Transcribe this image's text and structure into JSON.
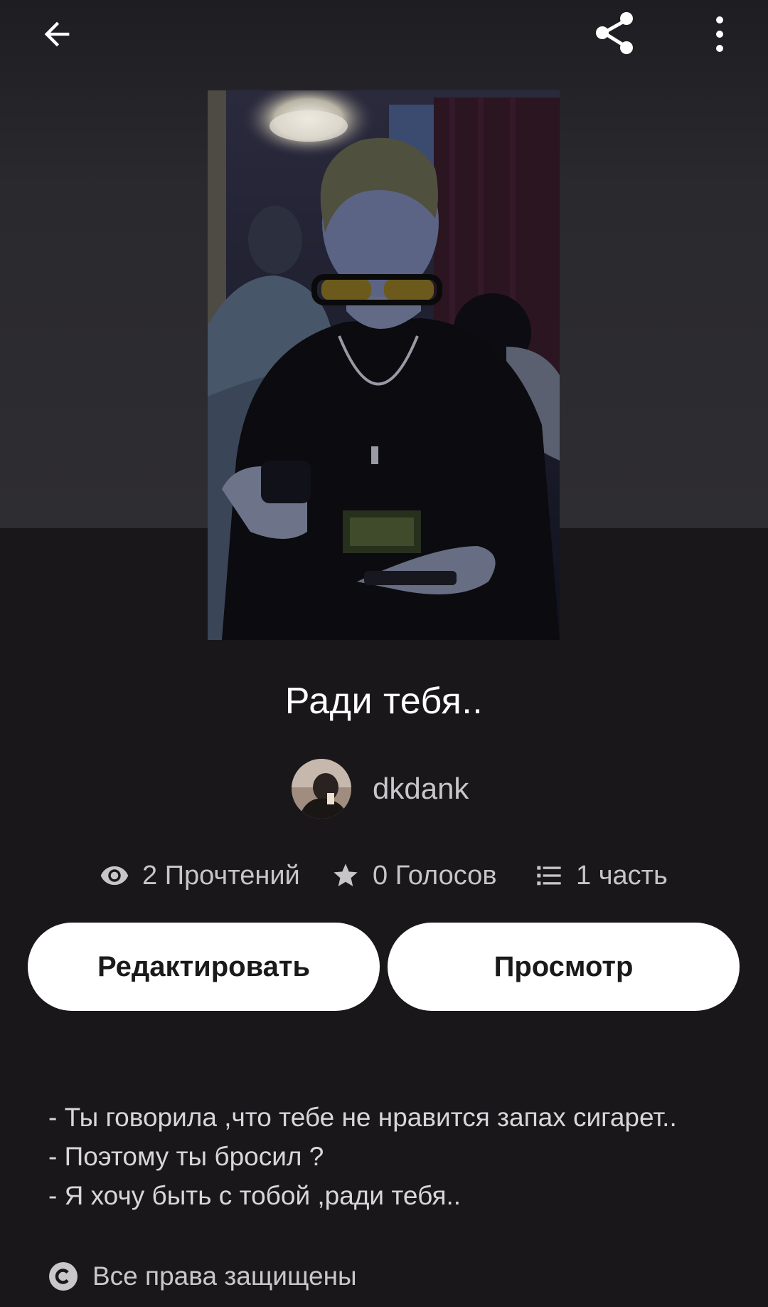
{
  "header": {
    "back_icon": "arrow-left-icon",
    "share_icon": "share-icon",
    "more_icon": "more-vertical-icon"
  },
  "story": {
    "title": "Ради тебя..",
    "author": "dkdank",
    "stats": {
      "reads": "2 Прочтений",
      "votes": "0 Голосов",
      "parts": "1 часть"
    }
  },
  "actions": {
    "edit_label": "Редактировать",
    "view_label": "Просмотр"
  },
  "description": {
    "lines": [
      "- Ты говорила ,что тебе не нравится запах сигарет..",
      "- Поэтому ты бросил ?",
      "- Я хочу быть с тобой ,ради тебя.."
    ]
  },
  "footer": {
    "copyright": "Все права защищены"
  },
  "colors": {
    "background": "#19171a",
    "hero": "#2e2d31",
    "button_bg": "#ffffff",
    "button_text": "#1a1a1a",
    "muted_text": "#c7c5c8"
  }
}
